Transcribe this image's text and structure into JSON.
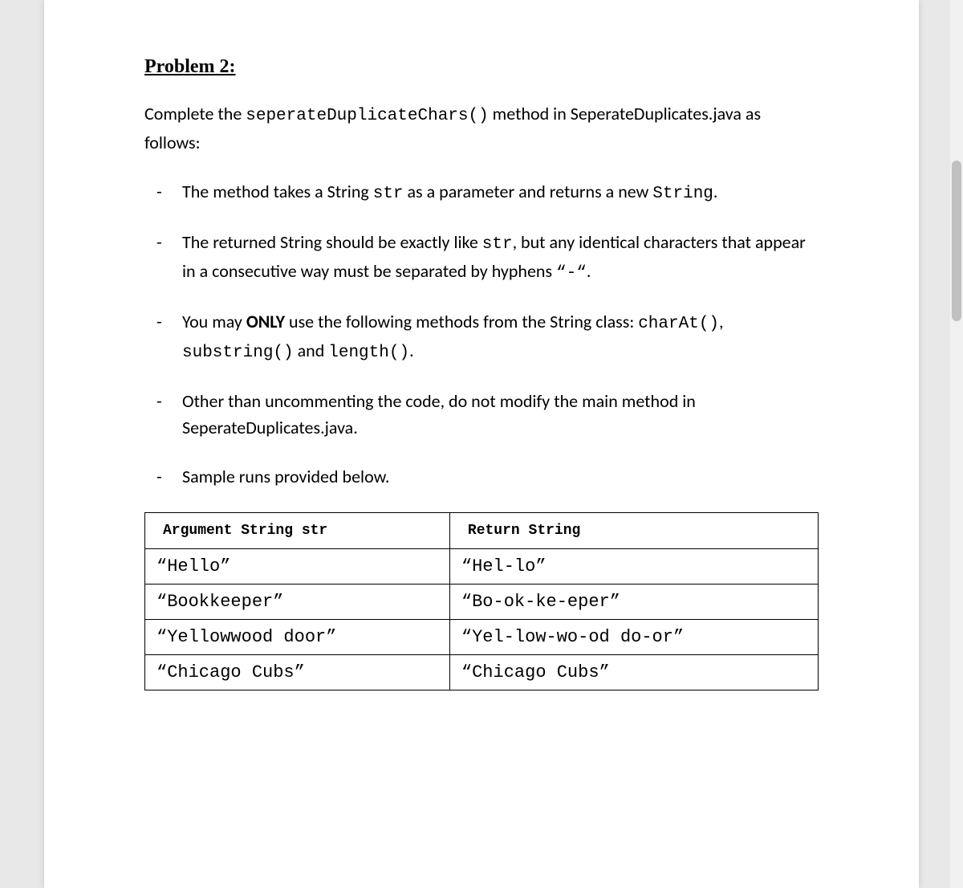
{
  "title": "Problem 2:",
  "intro": {
    "pre": "Complete the ",
    "method": "seperateDuplicateChars()",
    "mid": " method in SeperateDuplicates.java as follows:"
  },
  "bullets": [
    {
      "parts": [
        {
          "t": "The method takes a String ",
          "c": false
        },
        {
          "t": "str",
          "c": true
        },
        {
          "t": " as a parameter and returns a new ",
          "c": false
        },
        {
          "t": "String",
          "c": true
        },
        {
          "t": ".",
          "c": false
        }
      ]
    },
    {
      "parts": [
        {
          "t": "The returned String should be exactly like ",
          "c": false
        },
        {
          "t": "str",
          "c": true
        },
        {
          "t": ", but any identical characters that appear in a consecutive way must be separated by hyphens ",
          "c": false
        },
        {
          "t": "“-“",
          "c": true
        },
        {
          "t": ".",
          "c": false
        }
      ]
    },
    {
      "parts": [
        {
          "t": "You may ",
          "c": false
        },
        {
          "t": "ONLY",
          "c": false,
          "b": true
        },
        {
          "t": " use the following methods from the String class: ",
          "c": false
        },
        {
          "t": "charAt()",
          "c": true
        },
        {
          "t": ", ",
          "c": false
        },
        {
          "t": "substring()",
          "c": true
        },
        {
          "t": " and ",
          "c": false
        },
        {
          "t": "length()",
          "c": true
        },
        {
          "t": ".",
          "c": false
        }
      ]
    },
    {
      "parts": [
        {
          "t": "Other than uncommenting the code, do not modify the main method in SeperateDuplicates.java.",
          "c": false
        }
      ]
    },
    {
      "parts": [
        {
          "t": "Sample runs provided below.",
          "c": false
        }
      ]
    }
  ],
  "table": {
    "headers": [
      "Argument String str",
      "Return String"
    ],
    "rows": [
      [
        "“Hello”",
        "“Hel-lo”"
      ],
      [
        "“Bookkeeper”",
        "“Bo-ok-ke-eper”"
      ],
      [
        "“Yellowwood door”",
        "“Yel-low-wo-od do-or”"
      ],
      [
        "“Chicago Cubs”",
        "“Chicago Cubs”"
      ]
    ]
  }
}
